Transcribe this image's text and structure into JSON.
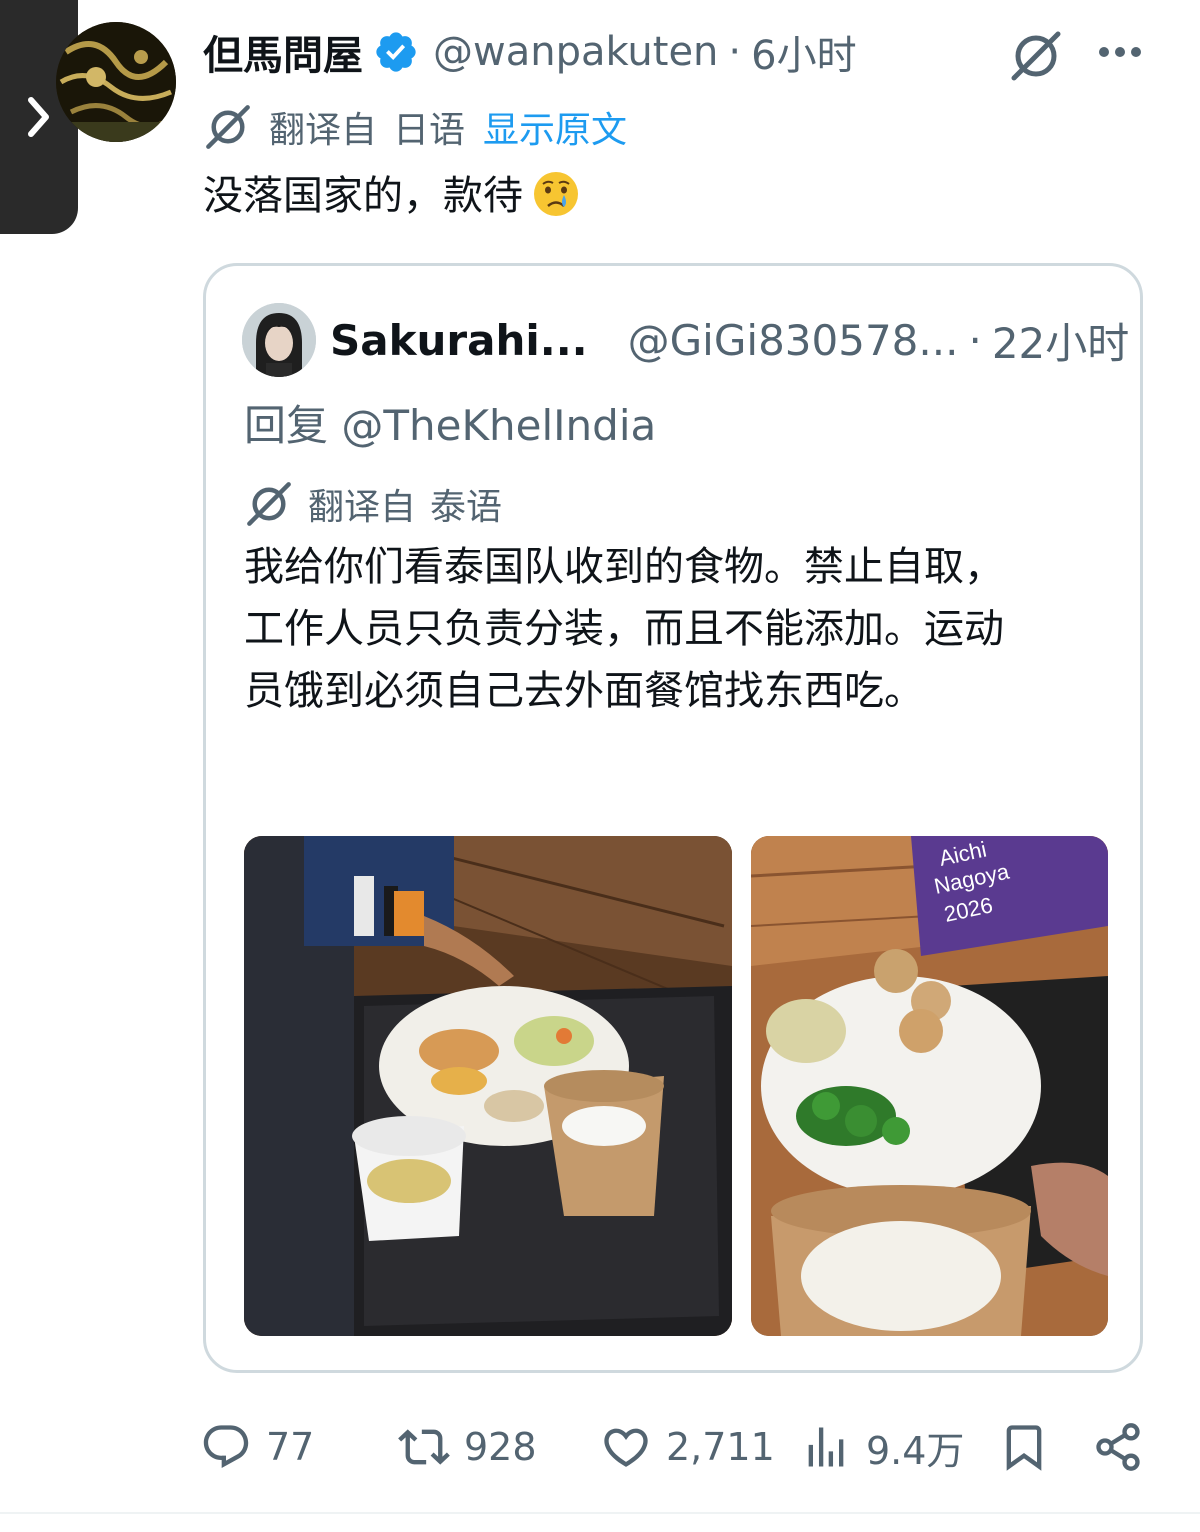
{
  "colors": {
    "link": "#1d9bf0",
    "muted": "#536471",
    "text": "#0f1419",
    "border": "#cfd9de"
  },
  "icons": {
    "side_tab": "chevron-right-icon",
    "verified": "verified-badge-icon",
    "grok": "grok-icon",
    "more": "more-icon",
    "translate": "translate-icon",
    "reply": "reply-icon",
    "retweet": "retweet-icon",
    "like": "heart-icon",
    "views": "views-icon",
    "bookmark": "bookmark-icon",
    "share": "share-icon"
  },
  "tweet": {
    "author_name": "但馬問屋",
    "handle": "@wanpakuten",
    "separator": "·",
    "time": "6小时",
    "translated_label": "翻译自",
    "translated_lang": "日语",
    "show_original": "显示原文",
    "text": "没落国家的，款待"
  },
  "quote": {
    "author_name": "Sakurahi...",
    "handle": "@GiGi830578...",
    "separator": "·",
    "time": "22小时",
    "reply_prefix": "回复",
    "reply_to": "@TheKhelIndia",
    "translated_label": "翻译自",
    "translated_lang": "泰语",
    "text_lines": [
      "我给你们看泰国队收到的食物。禁止自取，",
      "工作人员只负责分装，而且不能添加。运动",
      "员饿到必须自己去外面餐馆找东西吃。"
    ],
    "ellipsis": "...",
    "photo_banner_text": [
      "Aichi",
      "Nagoya",
      "2026"
    ]
  },
  "actions": {
    "replies": "77",
    "retweets": "928",
    "likes": "2,711",
    "views": "9.4万"
  }
}
